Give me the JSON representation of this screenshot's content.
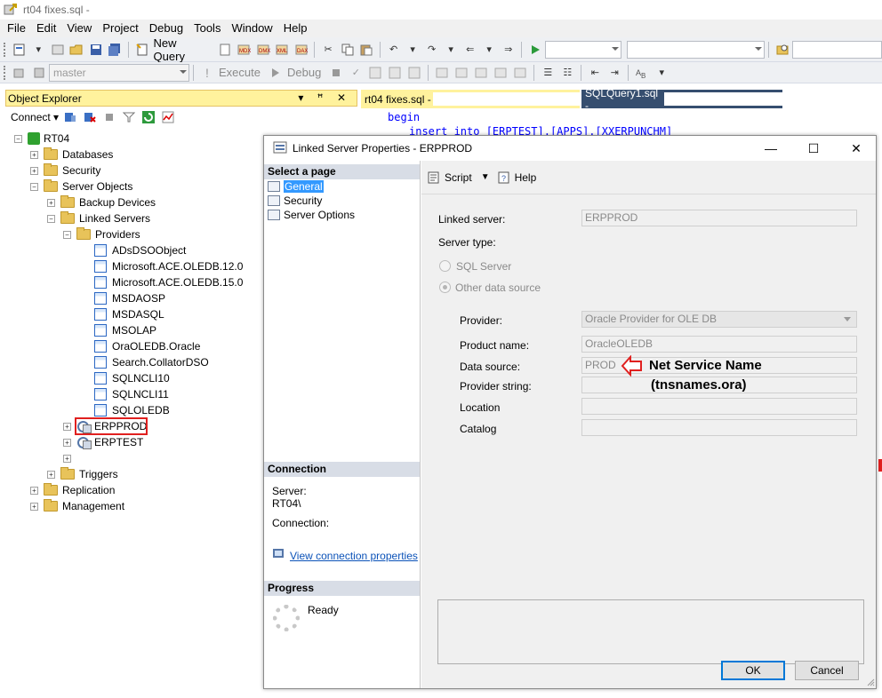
{
  "window": {
    "title": "rt04 fixes.sql -"
  },
  "menu": [
    "File",
    "Edit",
    "View",
    "Project",
    "Debug",
    "Tools",
    "Window",
    "Help"
  ],
  "toolbar1": {
    "new_query": "New Query"
  },
  "toolbar2": {
    "database": "master",
    "execute": "Execute",
    "debug": "Debug"
  },
  "object_explorer": {
    "title": "Object Explorer",
    "pin_glyphs": "▾ ꟸ ✕",
    "connect": "Connect",
    "tree": {
      "server": "RT04",
      "databases": "Databases",
      "security": "Security",
      "server_objects": "Server Objects",
      "backup_devices": "Backup Devices",
      "linked_servers": "Linked Servers",
      "providers": "Providers",
      "provider_list": [
        "ADsDSOObject",
        "Microsoft.ACE.OLEDB.12.0",
        "Microsoft.ACE.OLEDB.15.0",
        "MSDAOSP",
        "MSDASQL",
        "MSOLAP",
        "OraOLEDB.Oracle",
        "Search.CollatorDSO",
        "SQLNCLI10",
        "SQLNCLI11",
        "SQLOLEDB"
      ],
      "linked_list": [
        "ERPPROD",
        "ERPTEST"
      ],
      "triggers": "Triggers",
      "replication": "Replication",
      "management": "Management"
    }
  },
  "editor": {
    "tab1": "rt04 fixes.sql -",
    "tab2": "SQLQuery1.sql -",
    "line1": "begin",
    "line2": "insert into [ERPTEST].[APPS].[XXERPUNCHM]"
  },
  "dialog": {
    "title": "Linked Server Properties - ERPPROD",
    "select_page": "Select a page",
    "pages": [
      "General",
      "Security",
      "Server Options"
    ],
    "connection_head": "Connection",
    "server_label": "Server:",
    "server_value": "RT04\\",
    "connection_label": "Connection:",
    "view_connection": "View connection properties",
    "progress_head": "Progress",
    "progress_status": "Ready",
    "script": "Script",
    "help": "Help",
    "labels": {
      "linked_server": "Linked server:",
      "server_type": "Server type:",
      "sql_server": "SQL Server",
      "other_source": "Other data source",
      "provider": "Provider:",
      "product_name": "Product name:",
      "data_source": "Data source:",
      "provider_string": "Provider string:",
      "location": "Location",
      "catalog": "Catalog"
    },
    "values": {
      "linked_server": "ERPPROD",
      "provider": "Oracle Provider for OLE DB",
      "product_name": "OracleOLEDB",
      "data_source": "PROD"
    },
    "annotation": {
      "line1": "Net Service Name",
      "line2": "(tnsnames.ora)"
    },
    "ok": "OK",
    "cancel": "Cancel",
    "accent": "#e0201f"
  }
}
